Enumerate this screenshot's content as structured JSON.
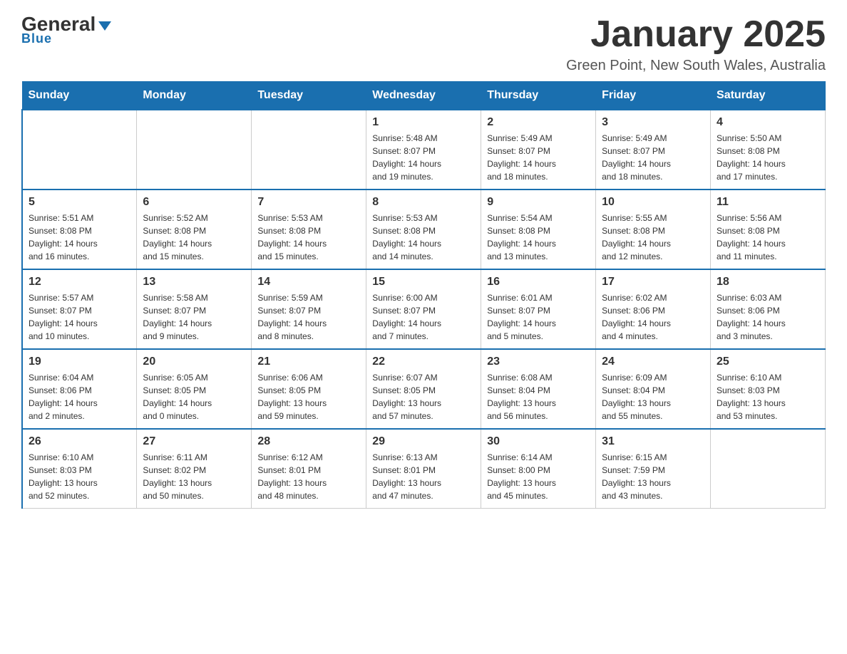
{
  "header": {
    "logo_main": "General",
    "logo_sub": "Blue",
    "title": "January 2025",
    "subtitle": "Green Point, New South Wales, Australia"
  },
  "days_of_week": [
    "Sunday",
    "Monday",
    "Tuesday",
    "Wednesday",
    "Thursday",
    "Friday",
    "Saturday"
  ],
  "weeks": [
    [
      {
        "day": "",
        "info": ""
      },
      {
        "day": "",
        "info": ""
      },
      {
        "day": "",
        "info": ""
      },
      {
        "day": "1",
        "info": "Sunrise: 5:48 AM\nSunset: 8:07 PM\nDaylight: 14 hours\nand 19 minutes."
      },
      {
        "day": "2",
        "info": "Sunrise: 5:49 AM\nSunset: 8:07 PM\nDaylight: 14 hours\nand 18 minutes."
      },
      {
        "day": "3",
        "info": "Sunrise: 5:49 AM\nSunset: 8:07 PM\nDaylight: 14 hours\nand 18 minutes."
      },
      {
        "day": "4",
        "info": "Sunrise: 5:50 AM\nSunset: 8:08 PM\nDaylight: 14 hours\nand 17 minutes."
      }
    ],
    [
      {
        "day": "5",
        "info": "Sunrise: 5:51 AM\nSunset: 8:08 PM\nDaylight: 14 hours\nand 16 minutes."
      },
      {
        "day": "6",
        "info": "Sunrise: 5:52 AM\nSunset: 8:08 PM\nDaylight: 14 hours\nand 15 minutes."
      },
      {
        "day": "7",
        "info": "Sunrise: 5:53 AM\nSunset: 8:08 PM\nDaylight: 14 hours\nand 15 minutes."
      },
      {
        "day": "8",
        "info": "Sunrise: 5:53 AM\nSunset: 8:08 PM\nDaylight: 14 hours\nand 14 minutes."
      },
      {
        "day": "9",
        "info": "Sunrise: 5:54 AM\nSunset: 8:08 PM\nDaylight: 14 hours\nand 13 minutes."
      },
      {
        "day": "10",
        "info": "Sunrise: 5:55 AM\nSunset: 8:08 PM\nDaylight: 14 hours\nand 12 minutes."
      },
      {
        "day": "11",
        "info": "Sunrise: 5:56 AM\nSunset: 8:08 PM\nDaylight: 14 hours\nand 11 minutes."
      }
    ],
    [
      {
        "day": "12",
        "info": "Sunrise: 5:57 AM\nSunset: 8:07 PM\nDaylight: 14 hours\nand 10 minutes."
      },
      {
        "day": "13",
        "info": "Sunrise: 5:58 AM\nSunset: 8:07 PM\nDaylight: 14 hours\nand 9 minutes."
      },
      {
        "day": "14",
        "info": "Sunrise: 5:59 AM\nSunset: 8:07 PM\nDaylight: 14 hours\nand 8 minutes."
      },
      {
        "day": "15",
        "info": "Sunrise: 6:00 AM\nSunset: 8:07 PM\nDaylight: 14 hours\nand 7 minutes."
      },
      {
        "day": "16",
        "info": "Sunrise: 6:01 AM\nSunset: 8:07 PM\nDaylight: 14 hours\nand 5 minutes."
      },
      {
        "day": "17",
        "info": "Sunrise: 6:02 AM\nSunset: 8:06 PM\nDaylight: 14 hours\nand 4 minutes."
      },
      {
        "day": "18",
        "info": "Sunrise: 6:03 AM\nSunset: 8:06 PM\nDaylight: 14 hours\nand 3 minutes."
      }
    ],
    [
      {
        "day": "19",
        "info": "Sunrise: 6:04 AM\nSunset: 8:06 PM\nDaylight: 14 hours\nand 2 minutes."
      },
      {
        "day": "20",
        "info": "Sunrise: 6:05 AM\nSunset: 8:05 PM\nDaylight: 14 hours\nand 0 minutes."
      },
      {
        "day": "21",
        "info": "Sunrise: 6:06 AM\nSunset: 8:05 PM\nDaylight: 13 hours\nand 59 minutes."
      },
      {
        "day": "22",
        "info": "Sunrise: 6:07 AM\nSunset: 8:05 PM\nDaylight: 13 hours\nand 57 minutes."
      },
      {
        "day": "23",
        "info": "Sunrise: 6:08 AM\nSunset: 8:04 PM\nDaylight: 13 hours\nand 56 minutes."
      },
      {
        "day": "24",
        "info": "Sunrise: 6:09 AM\nSunset: 8:04 PM\nDaylight: 13 hours\nand 55 minutes."
      },
      {
        "day": "25",
        "info": "Sunrise: 6:10 AM\nSunset: 8:03 PM\nDaylight: 13 hours\nand 53 minutes."
      }
    ],
    [
      {
        "day": "26",
        "info": "Sunrise: 6:10 AM\nSunset: 8:03 PM\nDaylight: 13 hours\nand 52 minutes."
      },
      {
        "day": "27",
        "info": "Sunrise: 6:11 AM\nSunset: 8:02 PM\nDaylight: 13 hours\nand 50 minutes."
      },
      {
        "day": "28",
        "info": "Sunrise: 6:12 AM\nSunset: 8:01 PM\nDaylight: 13 hours\nand 48 minutes."
      },
      {
        "day": "29",
        "info": "Sunrise: 6:13 AM\nSunset: 8:01 PM\nDaylight: 13 hours\nand 47 minutes."
      },
      {
        "day": "30",
        "info": "Sunrise: 6:14 AM\nSunset: 8:00 PM\nDaylight: 13 hours\nand 45 minutes."
      },
      {
        "day": "31",
        "info": "Sunrise: 6:15 AM\nSunset: 7:59 PM\nDaylight: 13 hours\nand 43 minutes."
      },
      {
        "day": "",
        "info": ""
      }
    ]
  ]
}
